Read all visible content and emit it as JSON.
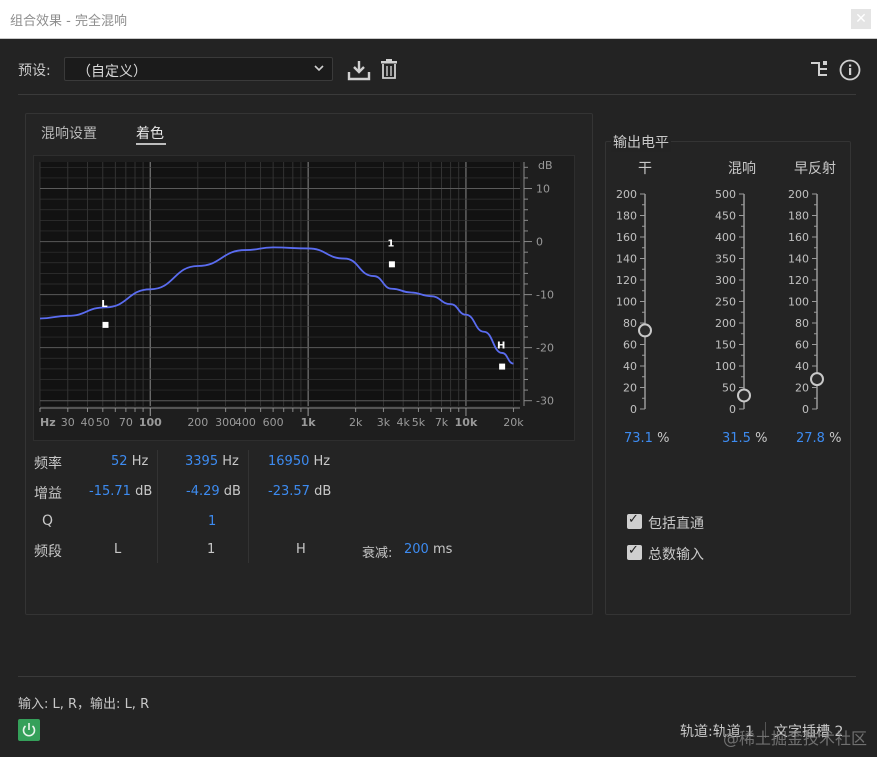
{
  "window": {
    "title": "组合效果 - 完全混响",
    "close_glyph": "✕"
  },
  "preset": {
    "label": "预设:",
    "value": "（自定义）"
  },
  "tabs": [
    {
      "label": "混响设置"
    },
    {
      "label": "着色"
    }
  ],
  "graph": {
    "y_axis_unit": "dB",
    "y_ticks": [
      "10",
      "0",
      "-10",
      "-20",
      "-30"
    ],
    "x_ticks": [
      "Hz",
      "30",
      "40",
      "50",
      "70",
      "100",
      "200",
      "300",
      "400",
      "600",
      "1k",
      "2k",
      "3k",
      "4k",
      "5k",
      "7k",
      "10k",
      "20k"
    ],
    "handles": [
      {
        "label": "L",
        "freq_hz": 52,
        "gain_db": -15.71
      },
      {
        "label": "1",
        "freq_hz": 3395,
        "gain_db": -4.29
      },
      {
        "label": "H",
        "freq_hz": 16950,
        "gain_db": -23.57
      }
    ],
    "curve": [
      [
        20,
        -14.5
      ],
      [
        30,
        -14
      ],
      [
        52,
        -12.4
      ],
      [
        100,
        -9
      ],
      [
        200,
        -4.6
      ],
      [
        400,
        -1.6
      ],
      [
        600,
        -1.1
      ],
      [
        1000,
        -1.3
      ],
      [
        1700,
        -3.2
      ],
      [
        2600,
        -6.5
      ],
      [
        3395,
        -8.9
      ],
      [
        4500,
        -9.6
      ],
      [
        6000,
        -10.3
      ],
      [
        8000,
        -11.8
      ],
      [
        10000,
        -13.8
      ],
      [
        13000,
        -17
      ],
      [
        16950,
        -21
      ],
      [
        20000,
        -23
      ]
    ],
    "curve_color": "#5a6cf0"
  },
  "params": {
    "freq_label": "频率",
    "gain_label": "增益",
    "q_label": "Q",
    "band_label": "频段",
    "bands": [
      {
        "freq": "52",
        "freq_unit": "Hz",
        "gain": "-15.71",
        "gain_unit": "dB",
        "q": "",
        "name": "L"
      },
      {
        "freq": "3395",
        "freq_unit": "Hz",
        "gain": "-4.29",
        "gain_unit": "dB",
        "q": "1",
        "name": "1"
      },
      {
        "freq": "16950",
        "freq_unit": "Hz",
        "gain": "-23.57",
        "gain_unit": "dB",
        "q": "",
        "name": "H"
      }
    ],
    "decay_label": "衰减:",
    "decay_value": "200",
    "decay_unit": "ms"
  },
  "output": {
    "title": "输出电平",
    "sliders": [
      {
        "label": "干",
        "ticks": [
          "200",
          "180",
          "160",
          "140",
          "120",
          "100",
          "80",
          "60",
          "40",
          "20",
          "0"
        ],
        "max": 200,
        "value": 73.1,
        "value_text": "73.1",
        "unit": "%"
      },
      {
        "label": "混响",
        "ticks": [
          "500",
          "450",
          "400",
          "350",
          "300",
          "250",
          "200",
          "150",
          "100",
          "50",
          "0"
        ],
        "max": 500,
        "value": 31.5,
        "value_text": "31.5",
        "unit": "%"
      },
      {
        "label": "早反射",
        "ticks": [
          "200",
          "180",
          "160",
          "140",
          "120",
          "100",
          "80",
          "60",
          "40",
          "20",
          "0"
        ],
        "max": 200,
        "value": 27.8,
        "value_text": "27.8",
        "unit": "%"
      }
    ],
    "checkboxes": [
      {
        "label": "包括直通",
        "checked": true
      },
      {
        "label": "总数输入",
        "checked": true
      }
    ]
  },
  "footer": {
    "io": "输入: L, R，输出: L, R",
    "track": "轨道:轨道 1",
    "slot": "文字插槽 2"
  },
  "watermark": "@稀土掘金技术社区",
  "colors": {
    "accent": "#3d8bf0",
    "power": "#35a05a",
    "background": "#232323"
  }
}
